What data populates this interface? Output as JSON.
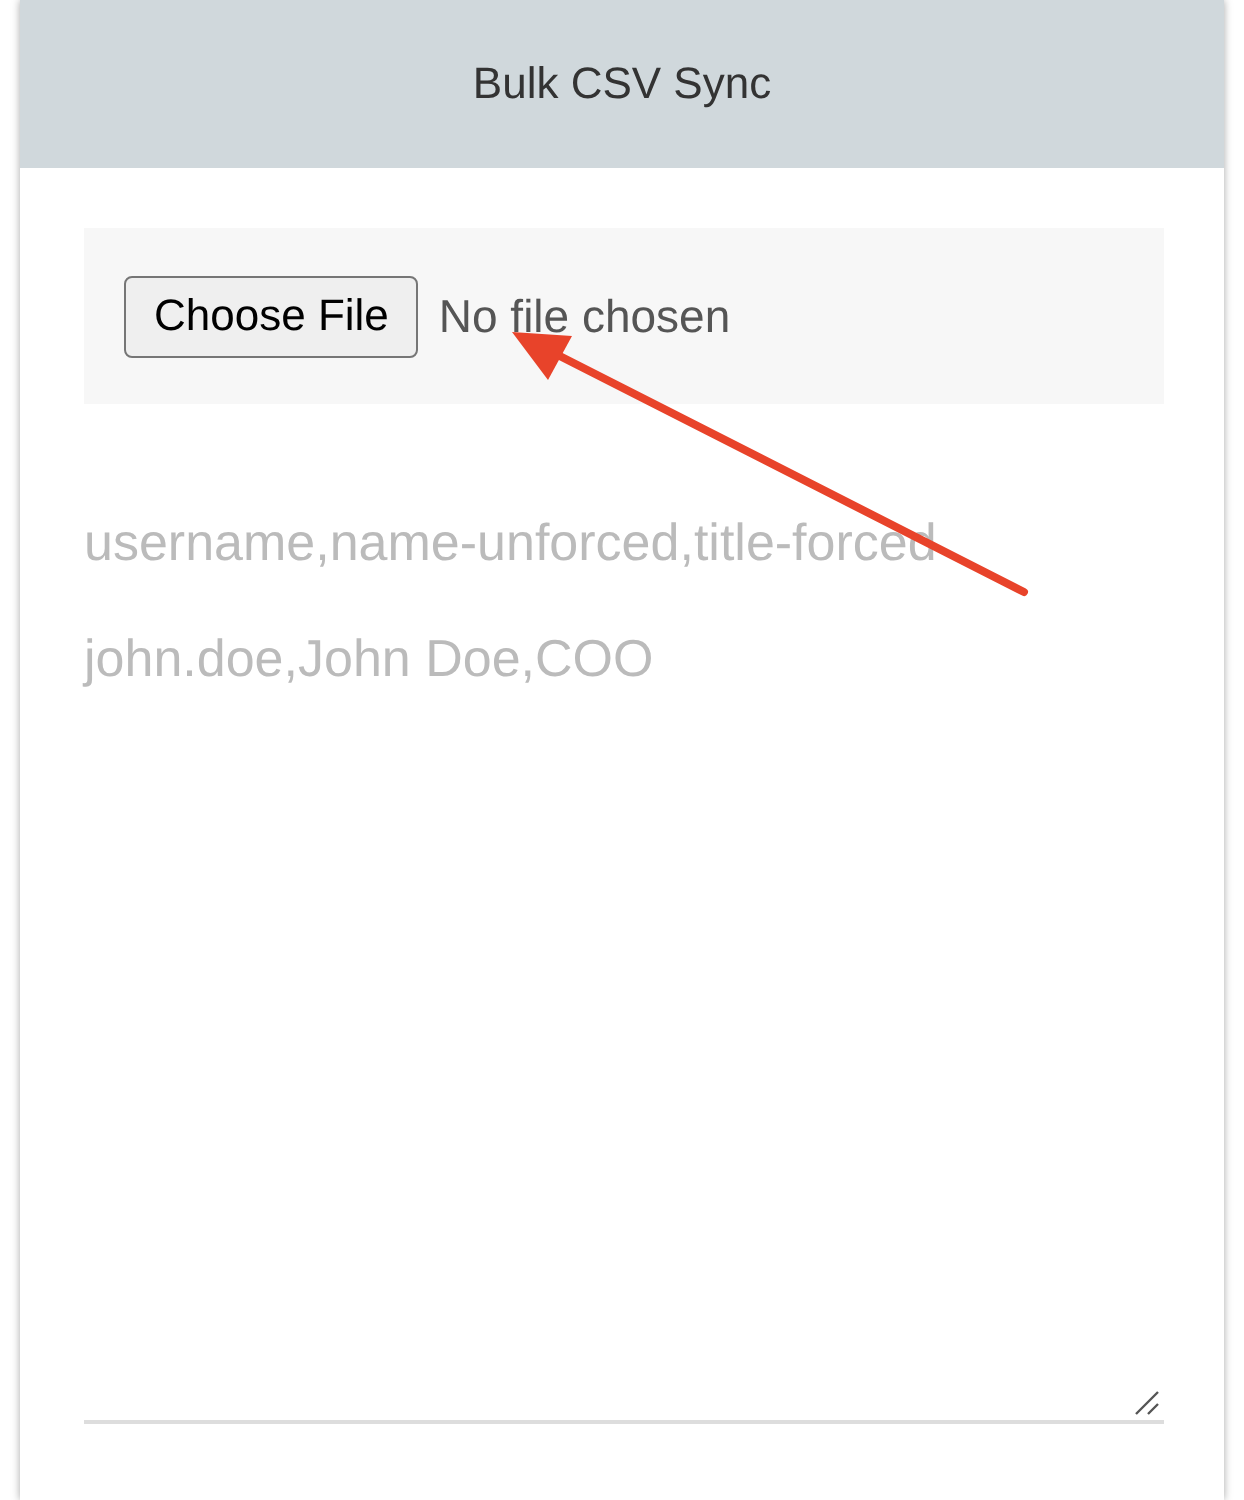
{
  "header": {
    "title": "Bulk CSV Sync"
  },
  "file_picker": {
    "button": "Choose File",
    "status": "No file chosen"
  },
  "csv_input": {
    "placeholder_lines": [
      "username,name-unforced,title-forced",
      "john.doe,John Doe,COO"
    ]
  },
  "annotation": {
    "kind": "arrow"
  }
}
